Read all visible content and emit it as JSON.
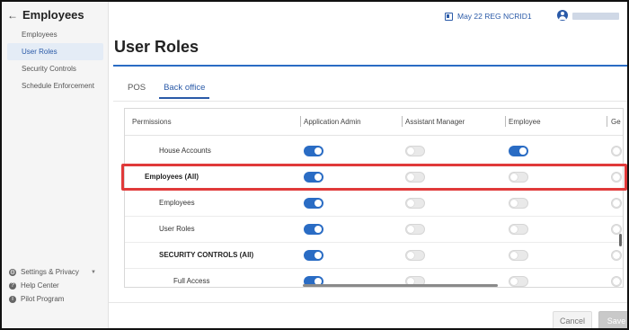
{
  "sidebar": {
    "title": "Employees",
    "items": [
      {
        "label": "Employees"
      },
      {
        "label": "User Roles"
      },
      {
        "label": "Security Controls"
      },
      {
        "label": "Schedule Enforcement"
      }
    ],
    "bottom": [
      {
        "label": "Settings & Privacy",
        "icon": "gear-icon"
      },
      {
        "label": "Help Center",
        "icon": "help-icon"
      },
      {
        "label": "Pilot Program",
        "icon": "info-icon"
      }
    ]
  },
  "topbar": {
    "store": "May 22 REG NCRID1"
  },
  "page": {
    "title": "User Roles"
  },
  "tabs": [
    {
      "label": "POS"
    },
    {
      "label": "Back office"
    }
  ],
  "table": {
    "headers": [
      "Permissions",
      "Application Admin",
      "Assistant Manager",
      "Employee",
      "Ge"
    ],
    "rows": [
      {
        "label": "House Accounts",
        "bold": false,
        "toggles": [
          "on",
          "off",
          "on",
          "off"
        ]
      },
      {
        "label": "Employees (All)",
        "bold": true,
        "toggles": [
          "on",
          "off",
          "off",
          "off"
        ]
      },
      {
        "label": "Employees",
        "bold": false,
        "toggles": [
          "on",
          "off",
          "off",
          "off"
        ]
      },
      {
        "label": "User Roles",
        "bold": false,
        "toggles": [
          "on",
          "off",
          "off",
          "off"
        ]
      },
      {
        "label": "SECURITY CONTROLS (All)",
        "bold": true,
        "toggles": [
          "on",
          "off",
          "off",
          "off"
        ]
      },
      {
        "label": "Full Access",
        "bold": false,
        "toggles": [
          "on",
          "off",
          "off",
          "off"
        ]
      }
    ]
  },
  "footer": {
    "cancel": "Cancel",
    "save": "Save"
  },
  "colors": {
    "accent": "#2a6cc4",
    "highlight": "#e03a3a"
  }
}
